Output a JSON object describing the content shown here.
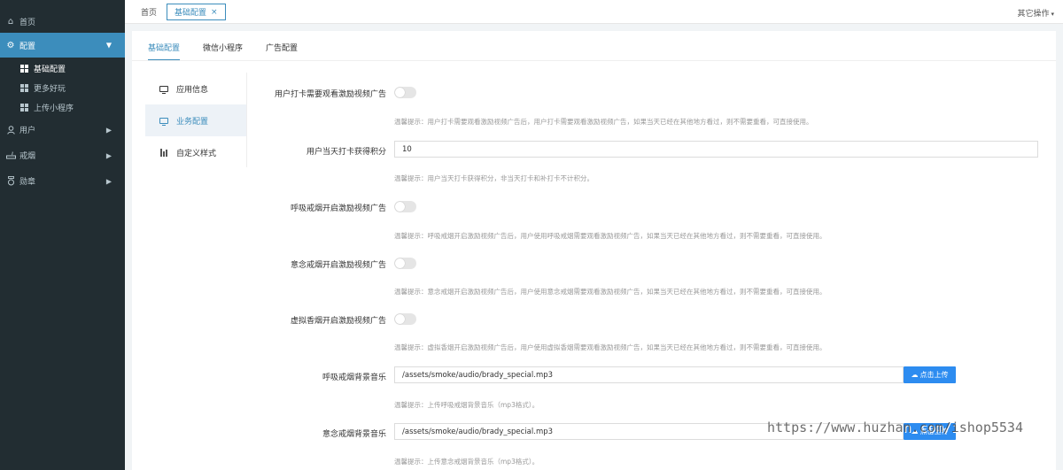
{
  "sidebar": {
    "home": "首页",
    "config": "配置",
    "sub_items": [
      "基础配置",
      "更多好玩",
      "上传小程序"
    ],
    "user": "用户",
    "quit_smoking": "戒烟",
    "medal": "勋章"
  },
  "topbar": {
    "tab_home": "首页",
    "tab_current": "基础配置",
    "close": "×",
    "other_ops": "其它操作",
    "other_ops_caret": "▾"
  },
  "panel": {
    "tabs": [
      "基础配置",
      "微信小程序",
      "广告配置"
    ],
    "menu": [
      "应用信息",
      "业务配置",
      "自定义样式"
    ]
  },
  "form": {
    "r1_label": "用户打卡需要观看激励视频广告",
    "r1_hint": "温馨提示：用户打卡需要观看激励视频广告后，用户打卡需要观看激励视频广告，如果当天已经在其他地方看过，则不需要重看，可直接使用。",
    "r2_label": "用户当天打卡获得积分",
    "r2_value": "10",
    "r2_hint": "温馨提示：用户当天打卡获得积分，非当天打卡和补打卡不计积分。",
    "r3_label": "呼吸戒烟开启激励视频广告",
    "r3_hint": "温馨提示：呼吸戒烟开启激励视频广告后，用户使用呼吸戒烟需要观看激励视频广告，如果当天已经在其他地方看过，则不需要重看，可直接使用。",
    "r4_label": "意念戒烟开启激励视频广告",
    "r4_hint": "温馨提示：意念戒烟开启激励视频广告后，用户使用意念戒烟需要观看激励视频广告，如果当天已经在其他地方看过，则不需要重看，可直接使用。",
    "r5_label": "虚拟香烟开启激励视频广告",
    "r5_hint": "温馨提示：虚拟香烟开启激励视频广告后，用户使用虚拟香烟需要观看激励视频广告，如果当天已经在其他地方看过，则不需要重看，可直接使用。",
    "r6_label": "呼吸戒烟背景音乐",
    "r6_value": "/assets/smoke/audio/brady_special.mp3",
    "r6_upload": "点击上传",
    "r6_hint": "温馨提示：上传呼吸戒烟背景音乐（mp3格式）。",
    "r7_label": "意念戒烟背景音乐",
    "r7_value": "/assets/smoke/audio/brady_special.mp3",
    "r7_upload": "点击上传",
    "r7_hint": "温馨提示：上传意念戒烟背景音乐（mp3格式）。"
  },
  "watermark": "https://www.huzhan.com/ishop5534",
  "colors": {
    "accent": "#3c8dbc",
    "sidebar_bg": "#222d32",
    "upload_btn": "#2d8cf0"
  }
}
